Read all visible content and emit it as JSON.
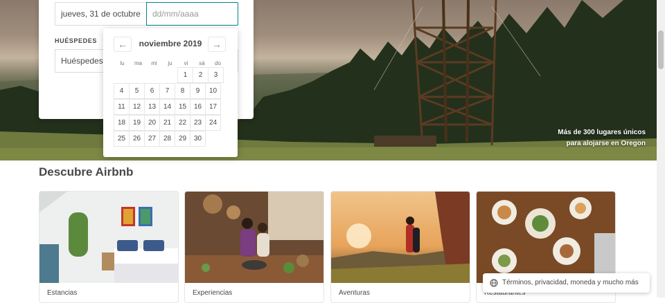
{
  "hero": {
    "caption_line1": "Más de 300 lugares únicos",
    "caption_line2": "para alojarse en Oregon"
  },
  "search": {
    "checkin_value": "jueves, 31 de octubre",
    "checkout_placeholder": "dd/mm/aaaa",
    "guests_label": "HUÉSPEDES",
    "guests_value": "Huéspedes"
  },
  "calendar": {
    "month_title": "noviembre 2019",
    "prev_icon": "←",
    "next_icon": "→",
    "weekdays": [
      "lu",
      "ma",
      "mi",
      "ju",
      "vi",
      "sá",
      "do"
    ],
    "weeks": [
      [
        "",
        "",
        "",
        "",
        "1",
        "2",
        "3"
      ],
      [
        "4",
        "5",
        "6",
        "7",
        "8",
        "9",
        "10"
      ],
      [
        "11",
        "12",
        "13",
        "14",
        "15",
        "16",
        "17"
      ],
      [
        "18",
        "19",
        "20",
        "21",
        "22",
        "23",
        "24"
      ],
      [
        "25",
        "26",
        "27",
        "28",
        "29",
        "30",
        ""
      ]
    ]
  },
  "discover": {
    "title": "Descubre Airbnb",
    "cards": [
      {
        "label": "Estancias"
      },
      {
        "label": "Experiencias"
      },
      {
        "label": "Aventuras"
      },
      {
        "label": "Restaurantes"
      }
    ]
  },
  "footer": {
    "text": "Términos, privacidad, moneda y mucho más",
    "icon": "globe-icon"
  },
  "colors": {
    "accent": "#008489",
    "text": "#484848",
    "border": "#e4e7e7"
  }
}
